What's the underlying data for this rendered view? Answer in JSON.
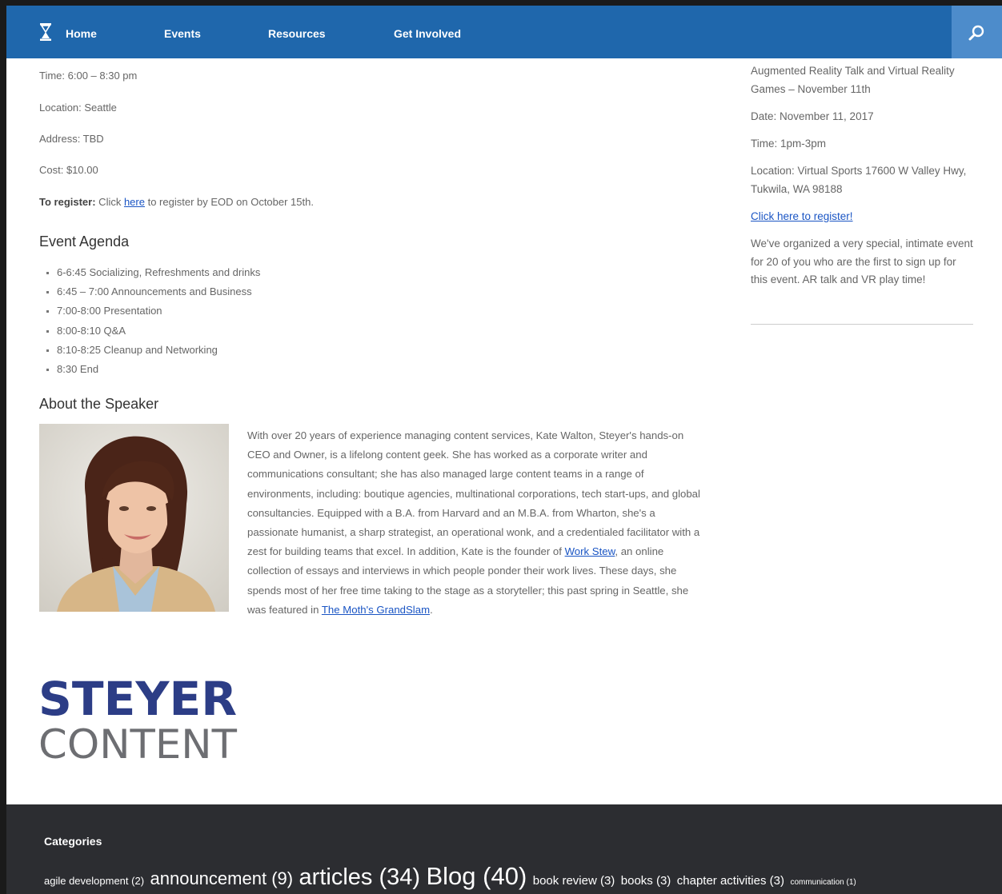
{
  "nav": {
    "items": [
      "Home",
      "Events",
      "Resources",
      "Get Involved"
    ]
  },
  "event": {
    "time": "Time: 6:00 – 8:30 pm",
    "location": "Location: Seattle",
    "address": "Address: TBD",
    "cost": "Cost: $10.00",
    "register_label": "To register:",
    "register_pre": " Click ",
    "register_link": "here",
    "register_post": " to register by EOD on October 15th."
  },
  "agenda": {
    "heading": "Event Agenda",
    "items": [
      "6-6:45 Socializing, Refreshments and drinks",
      "6:45 – 7:00 Announcements and Business",
      "7:00-8:00 Presentation",
      "8:00-8:10 Q&A",
      "8:10-8:25 Cleanup and Networking",
      "8:30 End"
    ]
  },
  "speaker": {
    "heading": "About the Speaker",
    "bio_1": "With over 20 years of experience managing content services, Kate Walton, Steyer's hands-on CEO and Owner, is a lifelong content geek. She has worked as a corporate writer and communications consultant; she has also managed large content teams in a range of environments, including: boutique agencies, multinational corporations, tech start-ups, and global consultancies. Equipped with a B.A. from Harvard and an M.B.A. from Wharton, she's a passionate humanist, a sharp strategist, an operational wonk, and a credentialed facilitator with a zest for building teams that excel. In addition, Kate is the founder of ",
    "link_1": "Work Stew",
    "bio_2": ", an online collection of essays and interviews in which people ponder their work lives. These days, she spends most of her free time taking to the stage as a storyteller; this past spring in Seattle, she was featured in ",
    "link_2": "The Moth's GrandSlam",
    "bio_3": "."
  },
  "logo": {
    "line1": "STEYER",
    "line2": "CONTENT",
    "brand_color": "#2c3d86"
  },
  "sidebar": {
    "title": "Augmented Reality Talk and Virtual Reality Games – November 11th",
    "date": "Date: November 11, 2017",
    "time": "Time: 1pm-3pm",
    "location": "Location: Virtual Sports 17600 W Valley Hwy, Tukwila, WA 98188",
    "register_link": "Click here to register!",
    "description": "We've organized a very special, intimate event for 20 of you who are the first to sign up for this event. AR talk and VR play time!"
  },
  "footer": {
    "categories_title": "Categories",
    "tags": [
      {
        "name": "agile development",
        "count": "(2)"
      },
      {
        "name": "announcement",
        "count": "(9)"
      },
      {
        "name": "articles",
        "count": "(34)"
      },
      {
        "name": "Blog",
        "count": "(40)"
      },
      {
        "name": "book review",
        "count": "(3)"
      },
      {
        "name": "books",
        "count": "(3)"
      },
      {
        "name": "chapter activities",
        "count": "(3)"
      },
      {
        "name": "communication",
        "count": "(1)"
      }
    ]
  },
  "colors": {
    "nav_bg": "#1f67ac",
    "search_bg": "#4d8ccb",
    "footer_bg": "#2c2d31",
    "link": "#1a55c4"
  }
}
